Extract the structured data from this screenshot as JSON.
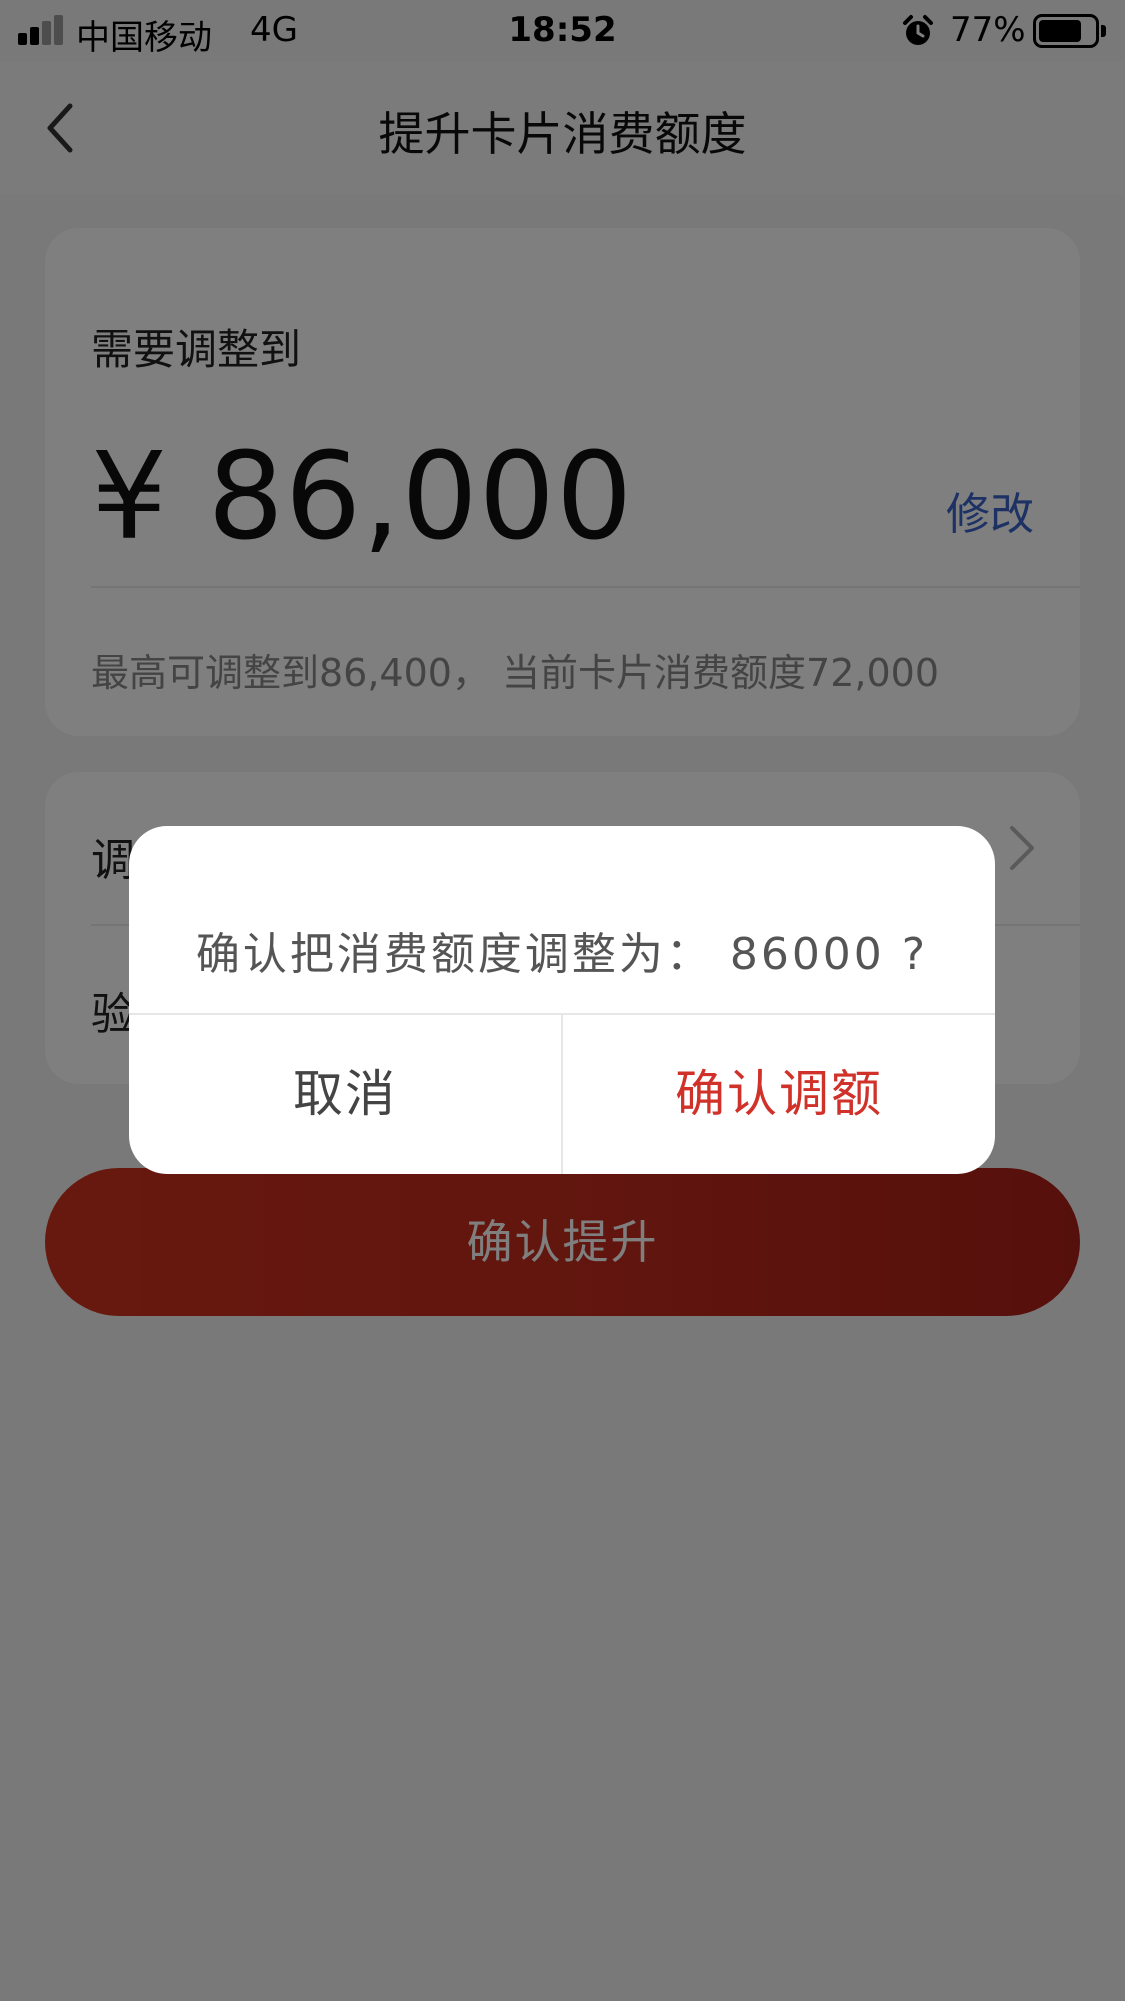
{
  "status_bar": {
    "carrier": "中国移动",
    "network": "4G",
    "time": "18:52",
    "battery": "77%",
    "battery_level": 0.77,
    "signal_bars": 2
  },
  "nav": {
    "title": "提升卡片消费额度",
    "back_icon": "chevron-left-icon"
  },
  "amount_card": {
    "label": "需要调整到",
    "amount": "¥ 86,000",
    "modify_label": "修改",
    "hint": "最高可调整到86,400， 当前卡片消费额度72,000"
  },
  "options": [
    {
      "label": "调"
    },
    {
      "label": "验"
    }
  ],
  "primary_button": {
    "label": "确认提升"
  },
  "dialog": {
    "message": "确认把消费额度调整为： 86000 ?",
    "cancel_label": "取消",
    "confirm_label": "确认调额"
  },
  "colors": {
    "accent_red": "#c8301f",
    "link_blue": "#3a62c8",
    "confirm_red": "#d0322a"
  }
}
